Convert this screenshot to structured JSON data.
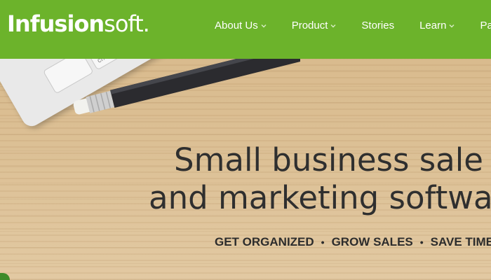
{
  "brand": {
    "logo_part1": "Infusion",
    "logo_part2": "soft",
    "logo_dot": "."
  },
  "nav": {
    "items": [
      {
        "label": "About Us",
        "has_dropdown": true
      },
      {
        "label": "Product",
        "has_dropdown": true
      },
      {
        "label": "Stories",
        "has_dropdown": false
      },
      {
        "label": "Learn",
        "has_dropdown": true
      },
      {
        "label": "Part",
        "has_dropdown": false
      }
    ]
  },
  "hero": {
    "keyboard_key_label": "cmd",
    "headline_line1": "Small business sale",
    "headline_line2": "and marketing softwa",
    "tagline": [
      "GET ORGANIZED",
      "GROW SALES",
      "SAVE TIME"
    ],
    "tagline_separator": "•"
  },
  "colors": {
    "header_green": "#6cb32b",
    "text_dark": "#2f2f2f",
    "wood": "#d9bb8e"
  }
}
